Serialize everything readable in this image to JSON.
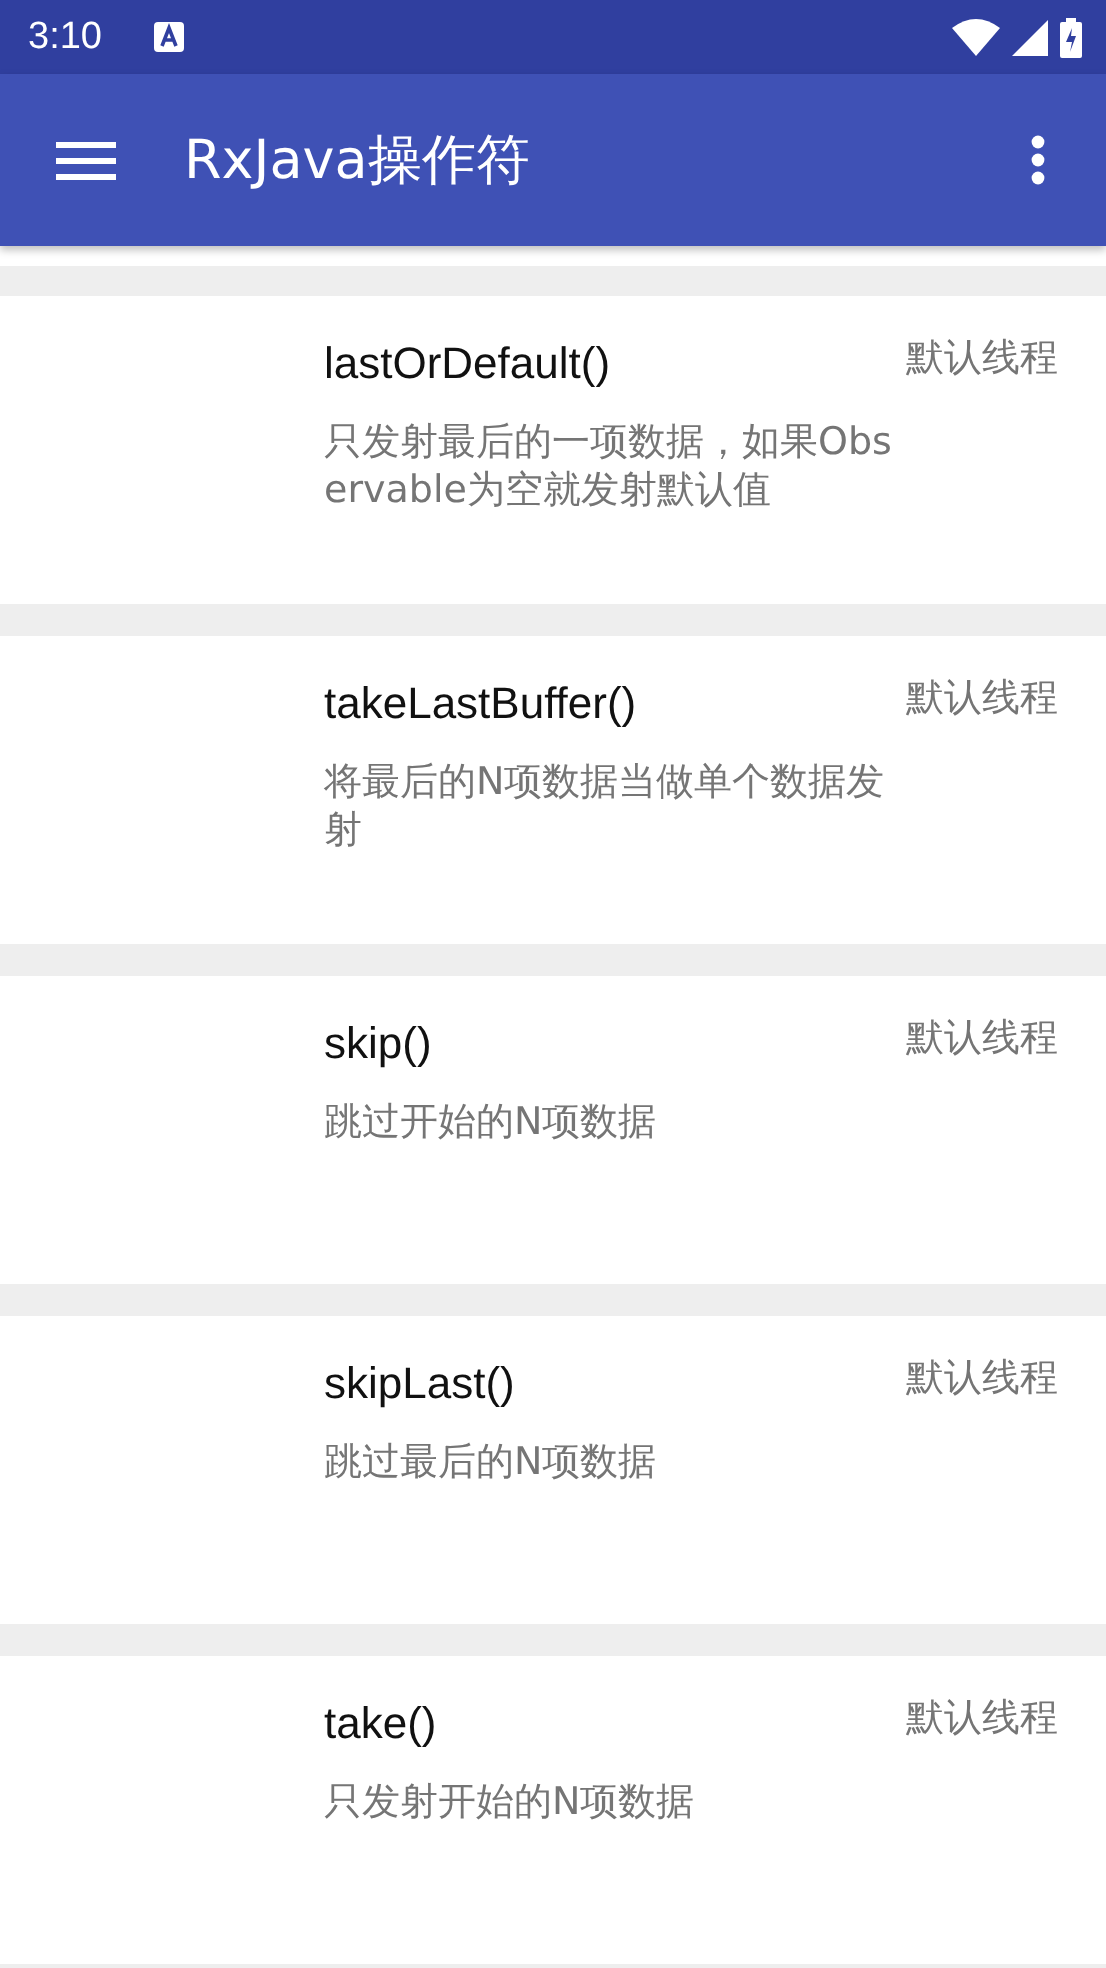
{
  "status_bar": {
    "time": "3:10"
  },
  "toolbar": {
    "title": "RxJava操作符"
  },
  "operators": [
    {
      "name": "lastOrDefault()",
      "thread": "默认线程",
      "description": "只发射最后的一项数据，如果Observable为空就发射默认值"
    },
    {
      "name": "takeLastBuffer()",
      "thread": "默认线程",
      "description": "将最后的N项数据当做单个数据发射"
    },
    {
      "name": "skip()",
      "thread": "默认线程",
      "description": "跳过开始的N项数据"
    },
    {
      "name": "skipLast()",
      "thread": "默认线程",
      "description": "跳过最后的N项数据"
    },
    {
      "name": "take()",
      "thread": "默认线程",
      "description": "只发射开始的N项数据"
    }
  ]
}
